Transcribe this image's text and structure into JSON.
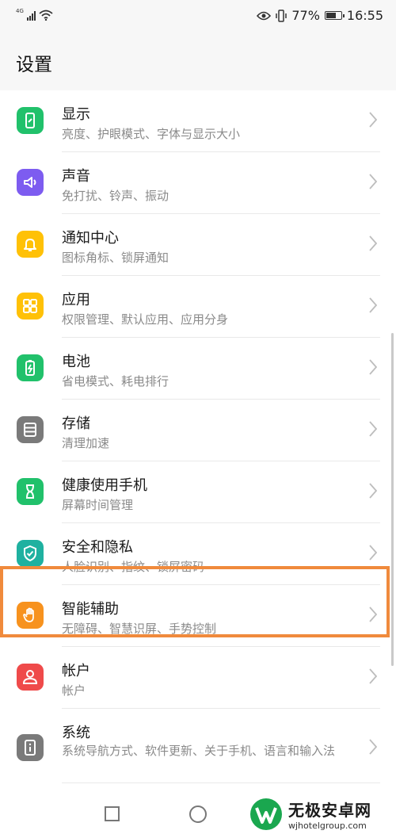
{
  "status_bar": {
    "network": "4G",
    "battery": "77%",
    "battery_level": 0.77,
    "time": "16:55",
    "icons": [
      "signal-icon",
      "wifi-icon",
      "eye-comfort-icon",
      "vibrate-icon",
      "battery-icon"
    ]
  },
  "header": {
    "title": "设置"
  },
  "settings": [
    {
      "title": "显示",
      "subtitle": "亮度、护眼模式、字体与显示大小",
      "icon": "display-icon",
      "color": "#21c16b"
    },
    {
      "title": "声音",
      "subtitle": "免打扰、铃声、振动",
      "icon": "sound-icon",
      "color": "#7d5cf0"
    },
    {
      "title": "通知中心",
      "subtitle": "图标角标、锁屏通知",
      "icon": "bell-icon",
      "color": "#ffc107"
    },
    {
      "title": "应用",
      "subtitle": "权限管理、默认应用、应用分身",
      "icon": "apps-icon",
      "color": "#ffc107"
    },
    {
      "title": "电池",
      "subtitle": "省电模式、耗电排行",
      "icon": "battery-icon",
      "color": "#21c16b"
    },
    {
      "title": "存储",
      "subtitle": "清理加速",
      "icon": "storage-icon",
      "color": "#7a7a7a"
    },
    {
      "title": "健康使用手机",
      "subtitle": "屏幕时间管理",
      "icon": "hourglass-icon",
      "color": "#21c16b"
    },
    {
      "title": "安全和隐私",
      "subtitle": "人脸识别、指纹、锁屏密码",
      "icon": "shield-icon",
      "color": "#1fb1a0"
    },
    {
      "title": "智能辅助",
      "subtitle": "无障碍、智慧识屏、手势控制",
      "icon": "hand-icon",
      "color": "#f7921e"
    },
    {
      "title": "帐户",
      "subtitle": "帐户",
      "icon": "account-icon",
      "color": "#ef4a4a"
    },
    {
      "title": "系统",
      "subtitle": "系统导航方式、软件更新、关于手机、语言和输入法",
      "icon": "system-info-icon",
      "color": "#7a7a7a"
    }
  ],
  "watermark": {
    "name": "无极安卓网",
    "url": "wjhotelgroup.com",
    "logo": "watermark-logo-icon"
  }
}
